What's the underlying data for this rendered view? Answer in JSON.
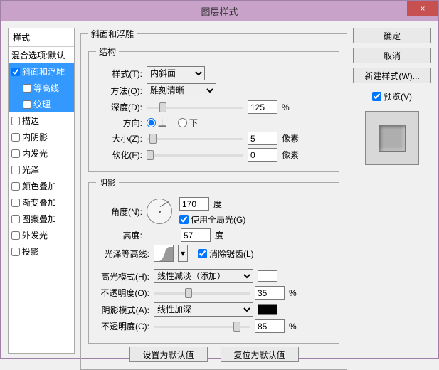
{
  "window": {
    "title": "图层样式"
  },
  "close": "×",
  "styles": {
    "header": "样式",
    "blend": "混合选项:默认",
    "items": [
      {
        "label": "斜面和浮雕",
        "checked": true,
        "selected": true
      },
      {
        "label": "等高线",
        "checked": false,
        "sub": true,
        "selected": true
      },
      {
        "label": "纹理",
        "checked": false,
        "sub": true,
        "selected": true
      },
      {
        "label": "描边",
        "checked": false
      },
      {
        "label": "内阴影",
        "checked": false
      },
      {
        "label": "内发光",
        "checked": false
      },
      {
        "label": "光泽",
        "checked": false
      },
      {
        "label": "颜色叠加",
        "checked": false
      },
      {
        "label": "渐变叠加",
        "checked": false
      },
      {
        "label": "图案叠加",
        "checked": false
      },
      {
        "label": "外发光",
        "checked": false
      },
      {
        "label": "投影",
        "checked": false
      }
    ]
  },
  "bevel": {
    "legend": "斜面和浮雕",
    "struct": {
      "legend": "结构",
      "style_label": "样式(T):",
      "style_value": "内斜面",
      "technique_label": "方法(Q):",
      "technique_value": "雕刻清晰",
      "depth_label": "深度(D):",
      "depth_value": "125",
      "depth_unit": "%",
      "direction_label": "方向:",
      "up": "上",
      "down": "下",
      "size_label": "大小(Z):",
      "size_value": "5",
      "size_unit": "像素",
      "soften_label": "软化(F):",
      "soften_value": "0",
      "soften_unit": "像素"
    },
    "shade": {
      "legend": "阴影",
      "angle_label": "角度(N):",
      "angle_value": "170",
      "angle_unit": "度",
      "global": "使用全局光(G)",
      "altitude_label": "高度:",
      "altitude_value": "57",
      "altitude_unit": "度",
      "gloss_label": "光泽等高线:",
      "antialias": "消除锯齿(L)",
      "hmode_label": "高光模式(H):",
      "hmode_value": "线性减淡（添加）",
      "hcolor": "#ffffff",
      "hopacity_label": "不透明度(O):",
      "hopacity_value": "35",
      "pct": "%",
      "smode_label": "阴影模式(A):",
      "smode_value": "线性加深",
      "scolor": "#000000",
      "sopacity_label": "不透明度(C):",
      "sopacity_value": "85"
    }
  },
  "buttons": {
    "ok": "确定",
    "cancel": "取消",
    "newstyle": "新建样式(W)...",
    "preview": "预览(V)",
    "default": "设置为默认值",
    "reset": "复位为默认值"
  }
}
